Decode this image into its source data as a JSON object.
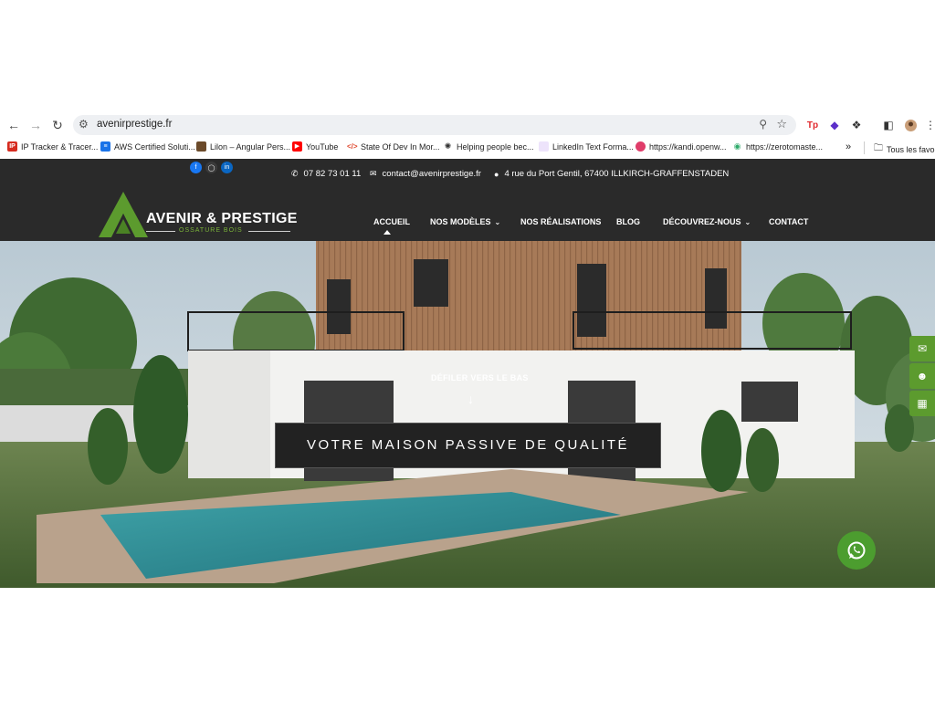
{
  "browser": {
    "url": "avenirprestige.fr",
    "bookmarks": [
      {
        "label": "IP Tracker & Tracer...",
        "icon": "ip-tracker-icon",
        "color": "#d62b1f"
      },
      {
        "label": "AWS Certified Soluti...",
        "icon": "aws-icon",
        "color": "#1a73e8"
      },
      {
        "label": "Lilon – Angular Pers...",
        "icon": "lilon-icon",
        "color": "#6b4a2a"
      },
      {
        "label": "YouTube",
        "icon": "youtube-icon",
        "color": "#ff0000"
      },
      {
        "label": "State Of Dev In Mor...",
        "icon": "code-icon",
        "color": "#e04a2f"
      },
      {
        "label": "Helping people bec...",
        "icon": "helping-icon",
        "color": "#333333"
      },
      {
        "label": "LinkedIn Text Forma...",
        "icon": "linkedin-format-icon",
        "color": "#d8c9f0"
      },
      {
        "label": "https://kandi.openw...",
        "icon": "kandi-icon",
        "color": "#e03d6a"
      },
      {
        "label": "https://zerotomaste...",
        "icon": "zerotomastery-icon",
        "color": "#2eaa6a"
      }
    ],
    "all_bookmarks_label": "Tous les favori",
    "more_label": "»"
  },
  "site": {
    "contact": {
      "phone": "07 82 73 01 11",
      "email": "contact@avenirprestige.fr",
      "address": "4 rue du Port Gentil, 67400 ILLKIRCH-GRAFFENSTADEN"
    },
    "logo": {
      "name": "AVENIR & PRESTIGE",
      "tagline": "OSSATURE BOIS"
    },
    "menu": [
      {
        "label": "ACCUEIL",
        "active": true,
        "dropdown": false
      },
      {
        "label": "NOS MODÈLES",
        "active": false,
        "dropdown": true
      },
      {
        "label": "NOS RÉALISATIONS",
        "active": false,
        "dropdown": false
      },
      {
        "label": "BLOG",
        "active": false,
        "dropdown": false
      },
      {
        "label": "DÉCOUVREZ-NOUS",
        "active": false,
        "dropdown": true
      },
      {
        "label": "CONTACT",
        "active": false,
        "dropdown": false
      }
    ],
    "hero": {
      "scroll_label": "DÉFILER VERS LE BAS",
      "title": "VOTRE MAISON PASSIVE DE QUALITÉ"
    }
  },
  "colors": {
    "header_bg": "#2a2a2a",
    "brand_green": "#5c9b2e",
    "whatsapp_green": "#4c9d2f"
  }
}
